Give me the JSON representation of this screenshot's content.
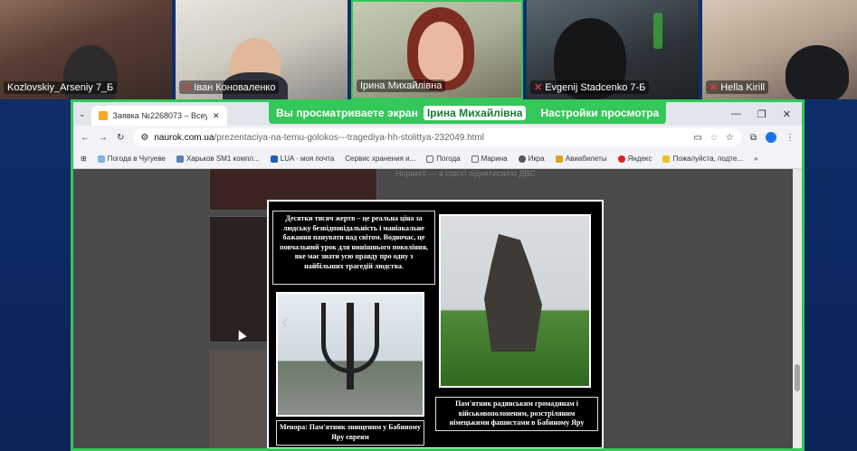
{
  "participants": [
    {
      "name": "Kozlovskiy_Arseniy 7_Б",
      "muted": false
    },
    {
      "name": "Іван Коноваленко",
      "muted": true
    },
    {
      "name": "Ірина Михайлівна",
      "muted": false
    },
    {
      "name": "Evgenij Stadcenko 7-Б",
      "muted": true
    },
    {
      "name": "Hella Kirill",
      "muted": true
    }
  ],
  "share_banner": {
    "prefix": "Вы просматриваете экран",
    "presenter": "Ірина Михайлівна",
    "settings": "Настройки просмотра"
  },
  "browser": {
    "tabs": [
      {
        "title": "Заявка №2268073 – Всеукраїн..."
      }
    ],
    "url_domain": "naurok.com.ua",
    "url_path": "/prezentaciya-na-temu-golokos---tragediya-hh-stolittya-232049.html",
    "bookmarks": [
      "Погода в Чугуеве",
      "Харьков SM1 компл...",
      "LUA · моя почта",
      "Сервис хранения и...",
      "Погода",
      "Марина",
      "Икра",
      "Авиабилеты",
      "Яндекс",
      "Пожалуйста, подте..."
    ],
    "bg_text": "Норвегії — в сов'єї піднятися/по ДВС"
  },
  "slide": {
    "main_caption": "Десятки тисяч жертв – це реальна ціна за людську безвідповідальність і маніакальне бажання панувати над світом. Водночас, це повчальний урок для нинішнього покоління, яке має знати усю правду про одну з найбільших трагедій людства.",
    "menorah_caption": "Менора: Пам'ятник знищеним у Бабиному Яру євреям",
    "monument_caption": "Пам'ятник радянським громадянам і військовополоненим, розстріляним німецькими фашистами в Бабиному Яру"
  },
  "colors": {
    "accent": "#34c759",
    "background": "#0d2a63"
  }
}
